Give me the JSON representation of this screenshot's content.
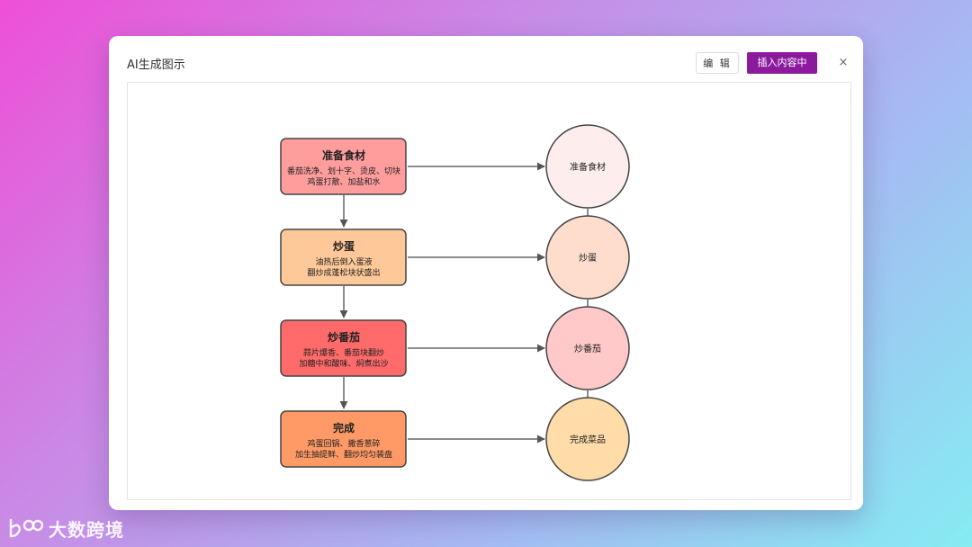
{
  "dialog": {
    "title": "AI生成图示",
    "edit_label": "编 辑",
    "insert_label": "插入内容中",
    "close_symbol": "×"
  },
  "diagram": {
    "steps": [
      {
        "title": "准备食材",
        "line1": "番茄洗净、划十字、烫皮、切块",
        "line2": "鸡蛋打散、加盐和水",
        "color": "#ff9d9d"
      },
      {
        "title": "炒蛋",
        "line1": "油热后倒入蛋液",
        "line2": "翻炒成蓬松块状盛出",
        "color": "#ffc898"
      },
      {
        "title": "炒番茄",
        "line1": "蒜片爆香、番茄块翻炒",
        "line2": "加糖中和酸味、焖煮出沙",
        "color": "#ff6a6a"
      },
      {
        "title": "完成",
        "line1": "鸡蛋回锅、撒香葱碎",
        "line2": "加生抽提鲜、翻炒均匀装盘",
        "color": "#ff9a66"
      }
    ],
    "circles": [
      {
        "label": "准备食材",
        "color": "#fdeeed"
      },
      {
        "label": "炒蛋",
        "color": "#ffddcc"
      },
      {
        "label": "炒番茄",
        "color": "#ffc9c9"
      },
      {
        "label": "完成菜品",
        "color": "#ffdca8"
      }
    ]
  },
  "watermark": {
    "text": "大数跨境"
  }
}
